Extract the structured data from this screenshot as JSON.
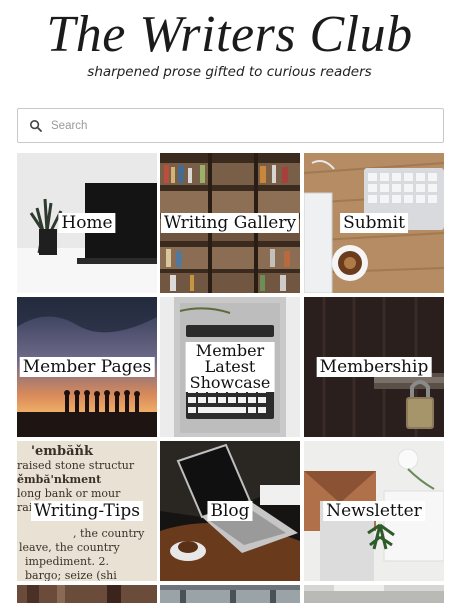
{
  "header": {
    "title": "The Writers Club",
    "tagline": "sharpened prose gifted to curious readers"
  },
  "search": {
    "placeholder": "Search",
    "value": ""
  },
  "tiles": [
    {
      "label": "Home"
    },
    {
      "label": "Writing Gallery"
    },
    {
      "label": "Submit"
    },
    {
      "label": "Member Pages"
    },
    {
      "label": "Member\nLatest Showcase"
    },
    {
      "label": "Membership"
    },
    {
      "label": "Writing-Tips"
    },
    {
      "label": "Blog"
    },
    {
      "label": "Newsletter"
    }
  ]
}
